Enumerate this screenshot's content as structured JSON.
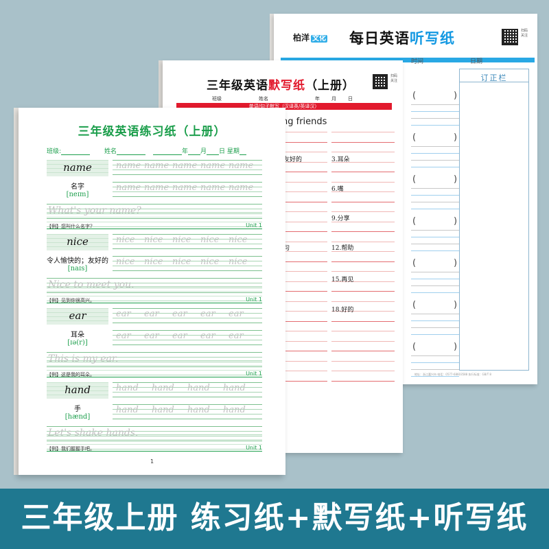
{
  "back_sheet": {
    "brand": "柏洋",
    "brand_tag": "文化",
    "title_black": "每日英语",
    "title_blue": "听写纸",
    "qr_caption": "扫码关注",
    "header_fields": [
      "时间",
      "日期"
    ],
    "correction_title": "订正栏",
    "footer": "地址：浙江嘉兴市 电话：0577-68603588 执行标准：GB/T 8"
  },
  "mid_sheet": {
    "title_black": "三年级英语",
    "title_red": "默写纸",
    "title_tail": "（上册）",
    "qr_caption": "扫码关注",
    "info": [
      "班级",
      "姓名",
      "年",
      "月",
      "日"
    ],
    "bar_text": "单词/句子默写（汉译英/英译汉）",
    "heading": "ng friends",
    "left_items": [
      "友好的",
      "",
      "",
      "",
      ""
    ],
    "right_items": [
      "3.耳朵",
      "6.嘴",
      "9.分享",
      "12.帮助",
      "15.再见",
      "18.好的"
    ],
    "left_tail": "句"
  },
  "front_sheet": {
    "title": "三年级英语练习纸（上册）",
    "info": {
      "class": "班级:",
      "name": "姓名",
      "year": "年",
      "month": "月",
      "day": "日",
      "weekday": "星期"
    },
    "units": [
      {
        "word": "name",
        "meaning": "名字",
        "phonetic": "[neɪm]",
        "trace": [
          "name",
          "name",
          "name",
          "name",
          "name"
        ],
        "sentence": "What's your name?",
        "example": "【例】您叫什么名字?",
        "unit": "Unit 1"
      },
      {
        "word": "nice",
        "meaning": "令人愉快的；友好的",
        "phonetic": "[naɪs]",
        "trace": [
          "nice",
          "nice",
          "nice",
          "nice",
          "nice"
        ],
        "sentence": "Nice to meet you.",
        "example": "【例】见到你很高兴。",
        "unit": "Unit 1"
      },
      {
        "word": "ear",
        "meaning": "耳朵",
        "phonetic": "[ɪə(r)]",
        "trace": [
          "ear",
          "ear",
          "ear",
          "ear",
          "ear"
        ],
        "sentence": "This is my ear.",
        "example": "【例】这是我的耳朵。",
        "unit": "Unit 1"
      },
      {
        "word": "hand",
        "meaning": "手",
        "phonetic": "[hænd]",
        "trace": [
          "hand",
          "hand",
          "hand",
          "hand"
        ],
        "sentence": "Let's shake hands.",
        "example": "【例】我们握握手吧。",
        "unit": "Unit 1"
      }
    ],
    "page_number": "1"
  },
  "banner": {
    "text": "三年级上册 练习纸+默写纸+听写纸"
  },
  "colors": {
    "green": "#1b9e4b",
    "red": "#e21a2d",
    "blue": "#1499e2",
    "banner": "#1f7890",
    "background": "#a9c1c9"
  }
}
